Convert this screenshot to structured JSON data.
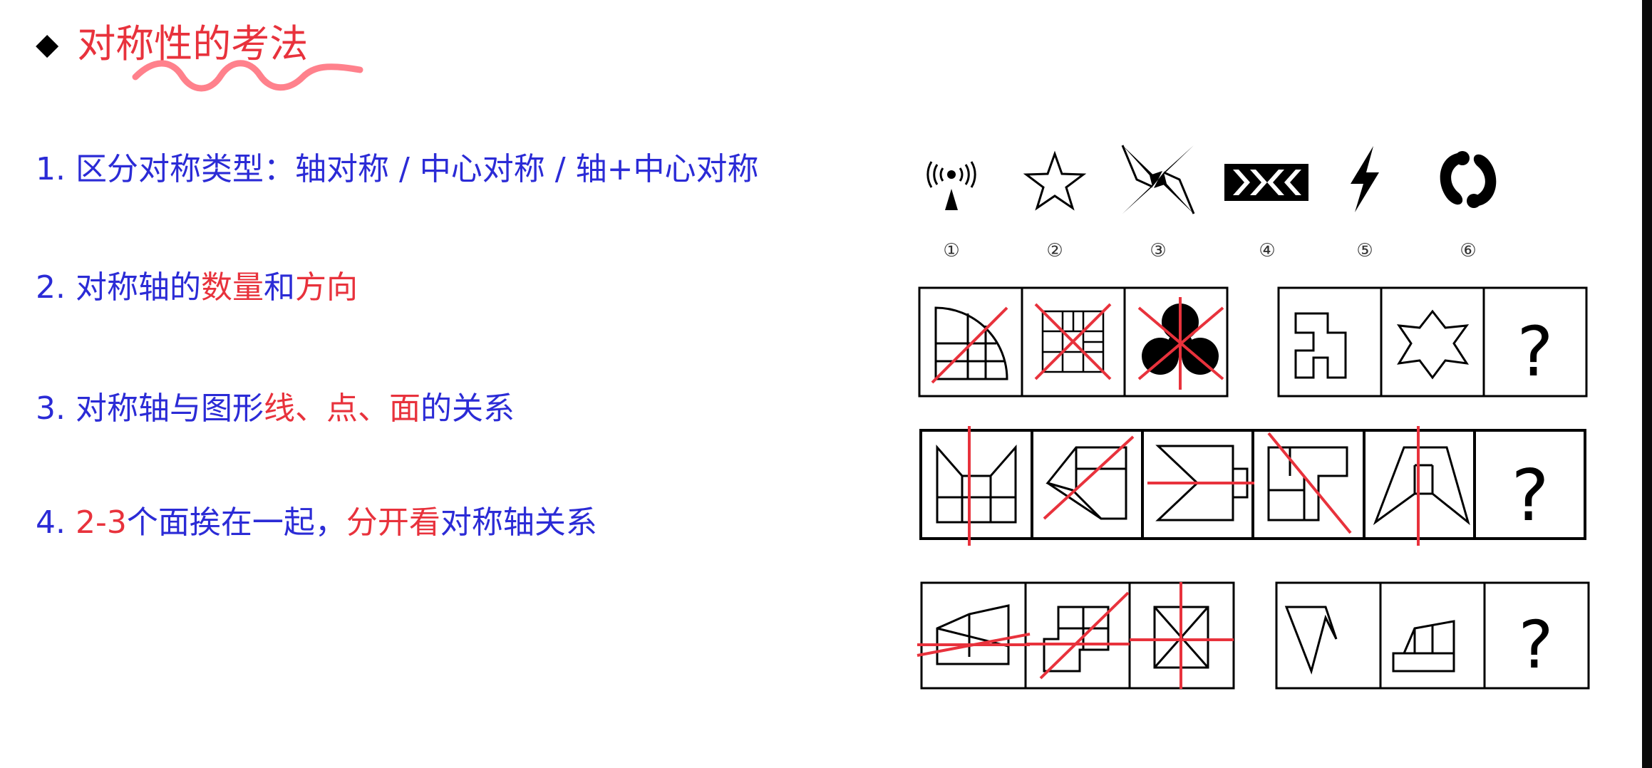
{
  "title": "对称性的考法",
  "points": [
    {
      "num": "1.",
      "parts": [
        {
          "t": "区分对称类型：轴对称 / 中心对称 / 轴+中心对称",
          "c": "blue"
        }
      ]
    },
    {
      "num": "2.",
      "parts": [
        {
          "t": "对称轴的",
          "c": "blue"
        },
        {
          "t": "数量",
          "c": "red"
        },
        {
          "t": "和",
          "c": "blue"
        },
        {
          "t": "方向",
          "c": "red"
        }
      ]
    },
    {
      "num": "3.",
      "parts": [
        {
          "t": "对称轴与图形",
          "c": "blue"
        },
        {
          "t": "线、点、面",
          "c": "red"
        },
        {
          "t": "的关系",
          "c": "blue"
        }
      ]
    },
    {
      "num": "4.",
      "parts": [
        {
          "t": "2-3",
          "c": "red"
        },
        {
          "t": "个面挨在一起，",
          "c": "blue"
        },
        {
          "t": "分开看",
          "c": "red"
        },
        {
          "t": "对称轴关系",
          "c": "blue"
        }
      ]
    }
  ],
  "symbols": {
    "labels": [
      "①",
      "②",
      "③",
      "④",
      "⑤",
      "⑥"
    ],
    "icons": [
      "antenna-icon",
      "star-icon",
      "pinwheel-icon",
      "chevron-strip-icon",
      "lightning-icon",
      "yin-yang-icon"
    ]
  },
  "puzzles": {
    "question_mark": "?"
  },
  "colors": {
    "blue": "#2b2bd6",
    "red": "#e8323c",
    "black": "#000000"
  }
}
